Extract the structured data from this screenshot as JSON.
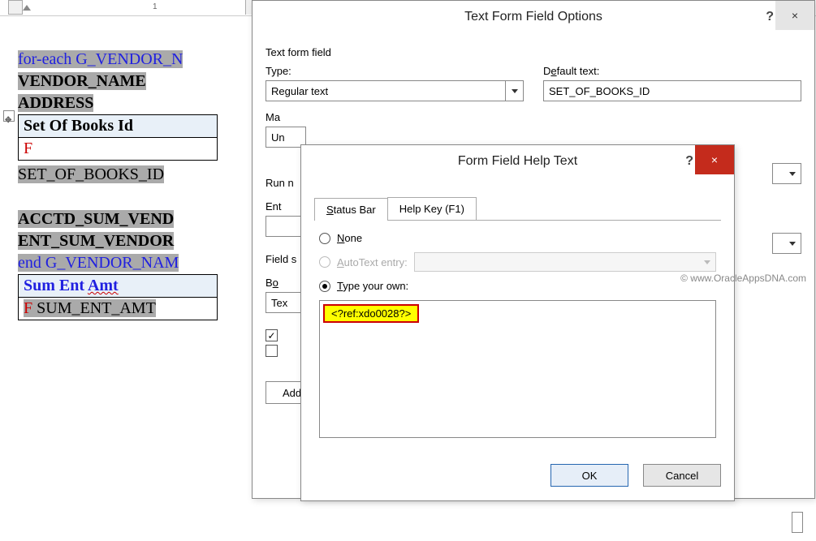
{
  "ruler": {
    "num1": "1"
  },
  "doc": {
    "foreach": "for-each G_VENDOR_N",
    "vendor_name": "VENDOR_NAME",
    "address": "ADDRESS",
    "set_of_books_hdr": "Set Of Books Id",
    "f1": "F",
    "set_of_books_id": "SET_OF_BOOKS_ID",
    "acctd": "ACCTD_SUM_VEND",
    "ent_sum": "ENT_SUM_VENDOR",
    "end": "end G_VENDOR_NAM",
    "sum_ent_amt_hdr_pre": "Sum Ent ",
    "sum_ent_amt_hdr_wavy": "Amt",
    "f2": "F",
    "sum_ent_amt": " SUM_ENT_AMT"
  },
  "tff": {
    "title": "Text Form Field Options",
    "help_icon": "?",
    "close_icon": "×",
    "group": "Text form field",
    "type_label": "Type:",
    "type_value": "Regular text",
    "default_label_pre": "D",
    "default_label_und": "e",
    "default_label_post": "fault text:",
    "default_value": "SET_OF_BOOKS_ID",
    "max_label_pre": "Ma",
    "max_trunc": "Un",
    "run_label": "Run n",
    "entry_label": "Ent",
    "field_label": "Field s",
    "bookmark_pre": "B",
    "bookmark_und": "o",
    "text_trunc": "Tex",
    "check1": "✓",
    "add_btn": "Add"
  },
  "fht": {
    "title": "Form Field Help Text",
    "help_icon": "?",
    "close_icon": "×",
    "tab1_und": "S",
    "tab1_rest": "tatus Bar",
    "tab2": "Help Key (F1)",
    "radio_none_und": "N",
    "radio_none_rest": "one",
    "radio_autotext_und": "A",
    "radio_autotext_rest": "utoText entry:",
    "radio_type_und": "T",
    "radio_type_rest": "ype your own:",
    "textarea_value": "<?ref:xdo0028?>",
    "ok": "OK",
    "cancel": "Cancel"
  },
  "watermark": "© www.OracleAppsDNA.com"
}
